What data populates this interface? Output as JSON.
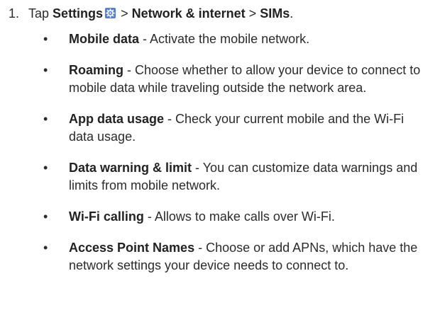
{
  "step": {
    "number": "1.",
    "tap": "Tap",
    "settings": "Settings",
    "sep1": ">",
    "network": "Network & internet",
    "sep2": ">",
    "sims": "SIMs",
    "end": "."
  },
  "settings_icon": "gear-icon",
  "bullet_glyph": "•",
  "items": [
    {
      "term": "Mobile data",
      "desc": " - Activate the mobile network."
    },
    {
      "term": "Roaming",
      "desc": " - Choose whether to allow your device to connect to mobile data while traveling outside the network area."
    },
    {
      "term": "App data usage",
      "desc": " - Check your current mobile and the Wi-Fi data usage."
    },
    {
      "term": "Data warning & limit",
      "desc": " - You can customize data warnings and limits from mobile network."
    },
    {
      "term": "Wi-Fi calling",
      "desc": " - Allows to make calls over Wi-Fi."
    },
    {
      "term": "Access Point Names",
      "desc": " - Choose or add APNs, which have the network settings your device needs to connect to."
    }
  ]
}
